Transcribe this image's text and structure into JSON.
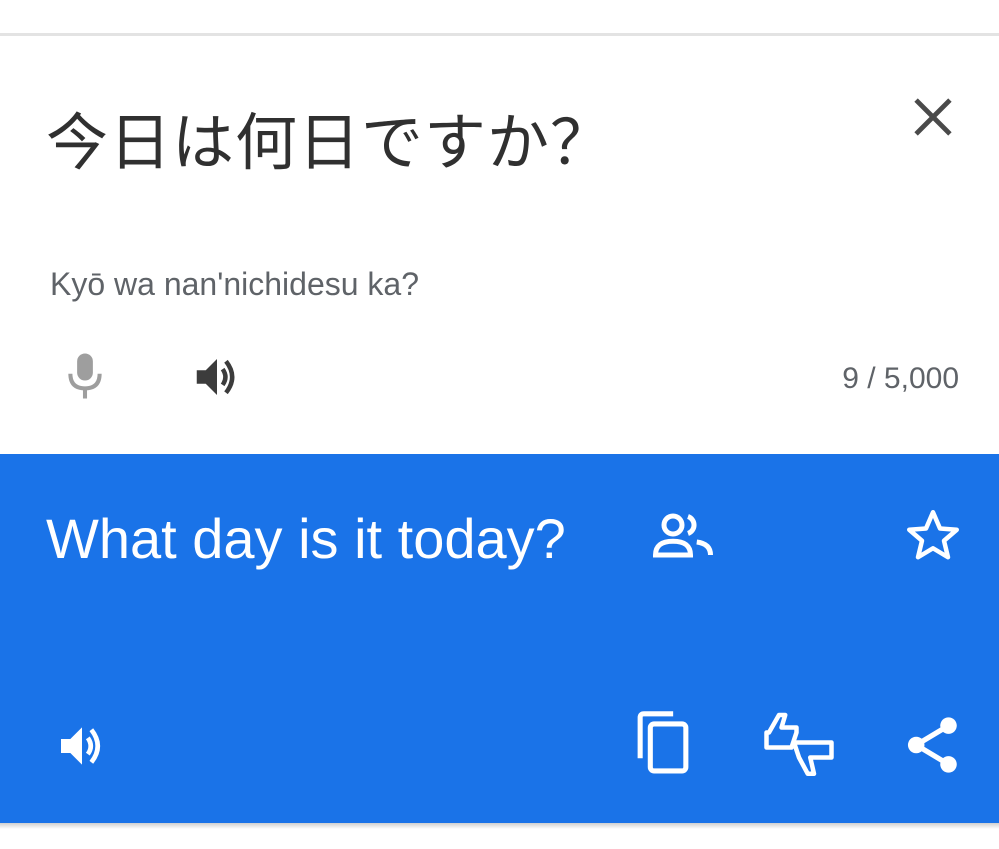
{
  "source": {
    "text": "今日は何日ですか？",
    "romanization": "Kyō wa nan'nichidesu ka?",
    "char_count": "9 / 5,000",
    "icons": {
      "close": "close-icon",
      "mic": "mic-icon",
      "speaker": "speaker-icon"
    }
  },
  "target": {
    "text": "What day is it today?",
    "icons": {
      "community": "community-verified-icon",
      "star": "star-outline-icon",
      "speaker": "speaker-icon",
      "copy": "copy-icon",
      "feedback": "thumbs-feedback-icon",
      "share": "share-icon"
    }
  },
  "colors": {
    "accent": "#1a73e8",
    "source_text": "#303030",
    "secondary_text": "#5f6368",
    "mic_disabled": "#9e9e9e"
  }
}
